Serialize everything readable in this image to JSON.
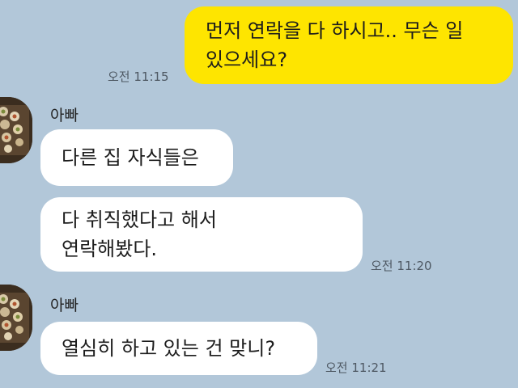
{
  "messages": {
    "m1": {
      "text": "먼저 연락을 다 하시고.. 무슨 일\n있으세요?",
      "time": "오전 11:15"
    },
    "m2": {
      "text": "다른 집 자식들은"
    },
    "m3": {
      "text": "다 취직했다고 해서\n연락해봤다.",
      "time": "오전 11:20"
    },
    "m4": {
      "text": "열심히 하고 있는 건 맞니?",
      "time": "오전 11:21"
    }
  },
  "groups": [
    {
      "sender": "아빠"
    },
    {
      "sender": "아빠"
    }
  ],
  "colors": {
    "background": "#b2c7d9",
    "my_bubble": "#fee500",
    "their_bubble": "#ffffff"
  },
  "icons": {
    "avatar": "food-plate-avatar"
  }
}
